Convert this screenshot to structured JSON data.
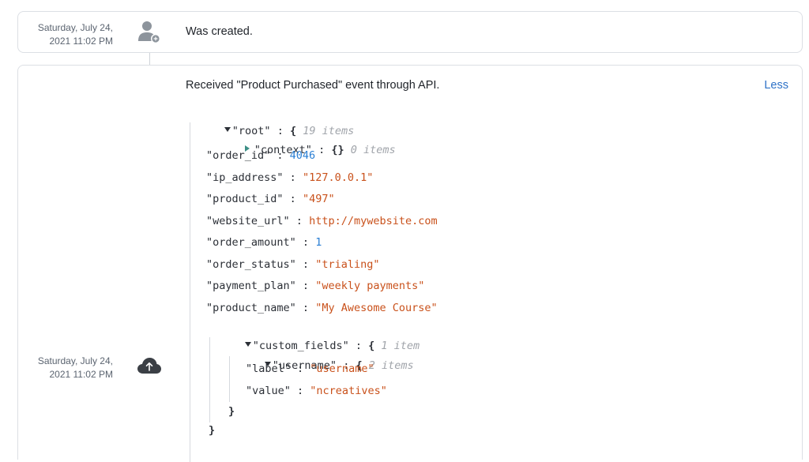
{
  "events": [
    {
      "timestamp_line1": "Saturday, July 24,",
      "timestamp_line2": "2021 11:02 PM",
      "icon": "user-add-icon",
      "message": "Was created."
    },
    {
      "timestamp_line1": "Saturday, July 24,",
      "timestamp_line2": "2021 11:02 PM",
      "icon": "cloud-upload-icon",
      "message": "Received \"Product Purchased\" event through API.",
      "toggle_label": "Less"
    }
  ],
  "json_tree": {
    "root_key": "\"root\"",
    "root_count": "19 items",
    "context_key": "\"context\"",
    "context_value": "{}",
    "context_count": "0 items",
    "rows": [
      {
        "key": "\"order_id\"",
        "value": "4046",
        "type": "num"
      },
      {
        "key": "\"ip_address\"",
        "value": "\"127.0.0.1\"",
        "type": "str"
      },
      {
        "key": "\"product_id\"",
        "value": "\"497\"",
        "type": "str"
      },
      {
        "key": "\"website_url\"",
        "value": "http://mywebsite.com",
        "type": "str"
      },
      {
        "key": "\"order_amount\"",
        "value": "1",
        "type": "num"
      },
      {
        "key": "\"order_status\"",
        "value": "\"trialing\"",
        "type": "str"
      },
      {
        "key": "\"payment_plan\"",
        "value": "\"weekly payments\"",
        "type": "str"
      },
      {
        "key": "\"product_name\"",
        "value": "\"My Awesome Course\"",
        "type": "str"
      }
    ],
    "custom_fields_key": "\"custom_fields\"",
    "custom_fields_count": "1 item",
    "username_key": "\"username\"",
    "username_count": "2 items",
    "label_key": "\"label\"",
    "label_value": "\"username\"",
    "value_key": "\"value\"",
    "value_value": "\"ncreatives\""
  },
  "colors": {
    "string": "#c9511b",
    "number": "#2a7fd4",
    "link": "#2e72c7",
    "expand_arrow": "#3d8f86"
  }
}
